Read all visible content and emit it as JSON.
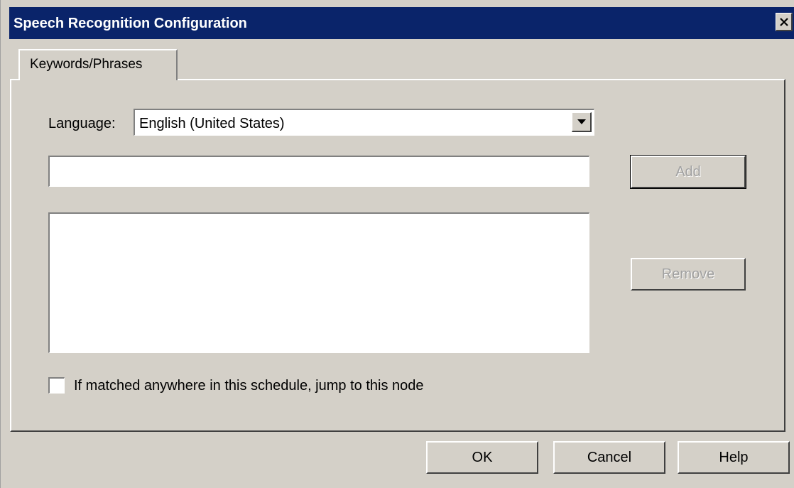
{
  "window": {
    "title": "Speech Recognition Configuration",
    "close_icon": "close-icon"
  },
  "tabs": [
    {
      "label": "Keywords/Phrases",
      "selected": true
    }
  ],
  "language": {
    "label": "Language:",
    "selected": "English (United States)"
  },
  "keyword_input": {
    "value": ""
  },
  "buttons": {
    "add": "Add",
    "remove": "Remove",
    "ok": "OK",
    "cancel": "Cancel",
    "help": "Help"
  },
  "keyword_list": {
    "items": []
  },
  "jump_option": {
    "label": "If matched anywhere in this schedule, jump to this node",
    "checked": false
  },
  "colors": {
    "titlebar": "#0a246a",
    "dialog_face": "#d4d0c8"
  }
}
